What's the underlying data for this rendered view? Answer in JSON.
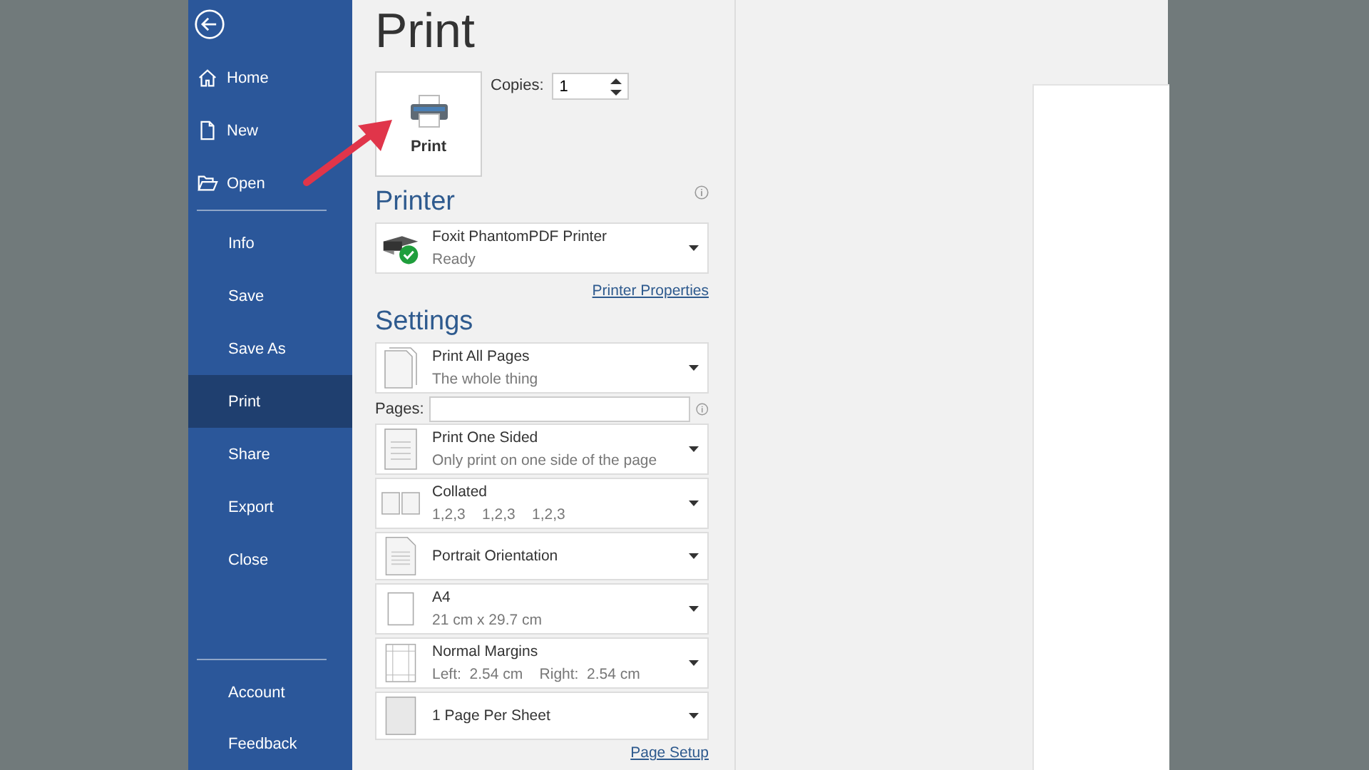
{
  "nav_top": [
    {
      "label": "Home",
      "kind": "home",
      "selected": false
    },
    {
      "label": "New",
      "kind": "new",
      "selected": false
    },
    {
      "label": "Open",
      "kind": "open",
      "selected": false
    }
  ],
  "nav_main": [
    {
      "label": "Info",
      "selected": false
    },
    {
      "label": "Save",
      "selected": false
    },
    {
      "label": "Save As",
      "selected": false
    },
    {
      "label": "Print",
      "selected": true
    },
    {
      "label": "Share",
      "selected": false
    },
    {
      "label": "Export",
      "selected": false
    },
    {
      "label": "Close",
      "selected": false
    }
  ],
  "nav_bottom": [
    {
      "label": "Account",
      "selected": false
    },
    {
      "label": "Feedback",
      "selected": false
    }
  ],
  "title": "Print",
  "print_button": "Print",
  "copies": {
    "label": "Copies:",
    "value": "1"
  },
  "printer": {
    "heading": "Printer",
    "name": "Foxit PhantomPDF Printer",
    "status": "Ready",
    "properties_link": "Printer Properties"
  },
  "settings": {
    "heading": "Settings",
    "items": [
      {
        "kind": "pages",
        "title": "Print All Pages",
        "subtitle": "The whole thing"
      },
      {
        "kind": "field",
        "label": "Pages:"
      },
      {
        "kind": "onesided",
        "title": "Print One Sided",
        "subtitle": "Only print on one side of the page"
      },
      {
        "kind": "collated",
        "title": "Collated",
        "subtitle": "1,2,3    1,2,3    1,2,3"
      },
      {
        "kind": "portrait",
        "title": "Portrait Orientation"
      },
      {
        "kind": "paper",
        "title": "A4",
        "subtitle": "21 cm x 29.7 cm"
      },
      {
        "kind": "margins",
        "title": "Normal Margins",
        "subtitle": "Left:  2.54 cm    Right:  2.54 cm"
      },
      {
        "kind": "sheet",
        "title": "1 Page Per Sheet"
      }
    ],
    "page_setup_link": "Page Setup"
  }
}
